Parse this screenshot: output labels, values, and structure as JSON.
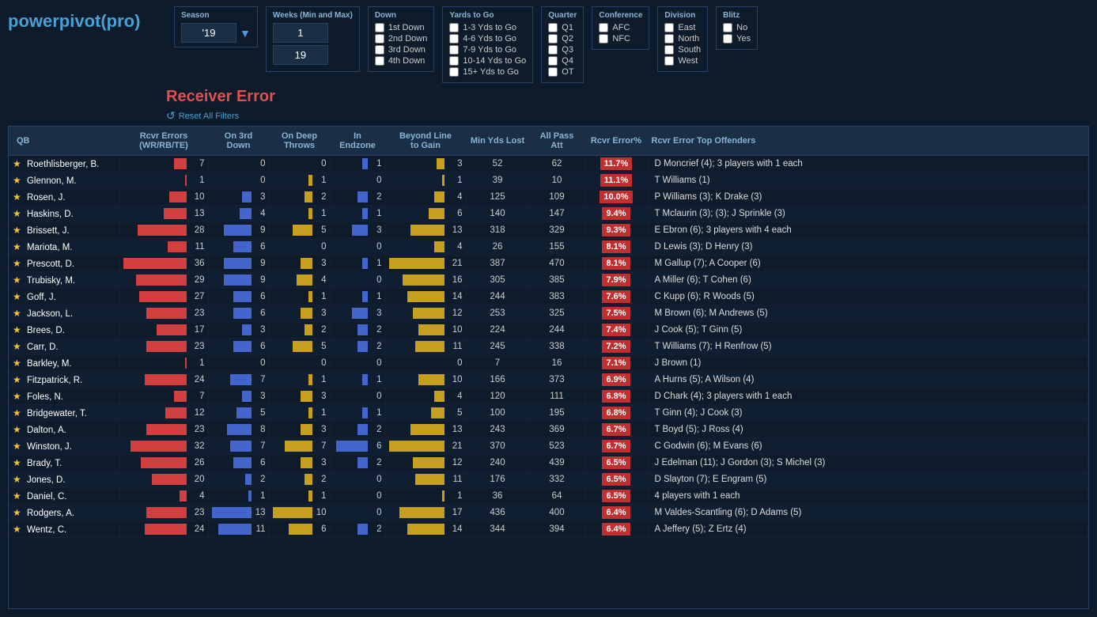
{
  "app": {
    "logo_prefix": "powerpivot",
    "logo_suffix": "(pro)",
    "subtitle": "Receiver Error",
    "reset_label": "Reset All Filters"
  },
  "season": {
    "label": "Season",
    "value": "'19"
  },
  "weeks": {
    "label": "Weeks (Min and Max)",
    "min": "1",
    "max": "19"
  },
  "down": {
    "label": "Down",
    "options": [
      "1st Down",
      "2nd Down",
      "3rd Down",
      "4th Down"
    ]
  },
  "yards_to_go": {
    "label": "Yards to Go",
    "options": [
      "1-3 Yds to Go",
      "4-6 Yds to Go",
      "7-9 Yds to Go",
      "10-14 Yds to Go",
      "15+ Yds to Go"
    ]
  },
  "quarter": {
    "label": "Quarter",
    "options": [
      "Q1",
      "Q2",
      "Q3",
      "Q4",
      "OT"
    ]
  },
  "conference": {
    "label": "Conference",
    "options": [
      "AFC",
      "NFC"
    ]
  },
  "division": {
    "label": "Division",
    "options": [
      "East",
      "North",
      "South",
      "West"
    ]
  },
  "blitz": {
    "label": "Blitz",
    "options": [
      "No",
      "Yes"
    ]
  },
  "table": {
    "headers": [
      "QB",
      "Rcvr Errors (WR/RB/TE)",
      "On 3rd Down",
      "On Deep Throws",
      "In Endzone",
      "Beyond Line to Gain",
      "Min Yds Lost",
      "All Pass Att",
      "Rcvr Error%",
      "Rcvr Error Top Offenders"
    ],
    "rows": [
      [
        "Roethlisberger, B.",
        "7",
        "0",
        "0",
        "1",
        "3",
        "52",
        "62",
        "11.7%",
        "D Moncrief (4); 3 players with 1 each",
        7,
        0,
        0,
        1,
        3
      ],
      [
        "Glennon, M.",
        "1",
        "0",
        "1",
        "0",
        "1",
        "39",
        "10",
        "11.1%",
        "T Williams (1)",
        1,
        0,
        1,
        0,
        1
      ],
      [
        "Rosen, J.",
        "10",
        "3",
        "2",
        "2",
        "4",
        "125",
        "109",
        "10.0%",
        "P Williams (3); K Drake (3)",
        10,
        3,
        2,
        2,
        4
      ],
      [
        "Haskins, D.",
        "13",
        "4",
        "1",
        "1",
        "6",
        "140",
        "147",
        "9.4%",
        "T Mclaurin (3); (3); J Sprinkle (3)",
        13,
        4,
        1,
        1,
        6
      ],
      [
        "Brissett, J.",
        "28",
        "9",
        "5",
        "3",
        "13",
        "318",
        "329",
        "9.3%",
        "E Ebron (6); 3 players with 4 each",
        28,
        9,
        5,
        3,
        13
      ],
      [
        "Mariota, M.",
        "11",
        "6",
        "0",
        "0",
        "4",
        "26",
        "155",
        "8.1%",
        "D Lewis (3); D Henry (3)",
        11,
        6,
        0,
        0,
        4
      ],
      [
        "Prescott, D.",
        "36",
        "9",
        "3",
        "1",
        "21",
        "387",
        "470",
        "8.1%",
        "M Gallup (7); A Cooper (6)",
        36,
        9,
        3,
        1,
        21
      ],
      [
        "Trubisky, M.",
        "29",
        "9",
        "4",
        "0",
        "16",
        "305",
        "385",
        "7.9%",
        "A Miller (6); T Cohen (6)",
        29,
        9,
        4,
        0,
        16
      ],
      [
        "Goff, J.",
        "27",
        "6",
        "1",
        "1",
        "14",
        "244",
        "383",
        "7.6%",
        "C Kupp (6); R Woods (5)",
        27,
        6,
        1,
        1,
        14
      ],
      [
        "Jackson, L.",
        "23",
        "6",
        "3",
        "3",
        "12",
        "253",
        "325",
        "7.5%",
        "M Brown (6); M Andrews (5)",
        23,
        6,
        3,
        3,
        12
      ],
      [
        "Brees, D.",
        "17",
        "3",
        "2",
        "2",
        "10",
        "224",
        "244",
        "7.4%",
        "J Cook (5); T Ginn (5)",
        17,
        3,
        2,
        2,
        10
      ],
      [
        "Carr, D.",
        "23",
        "6",
        "5",
        "2",
        "11",
        "245",
        "338",
        "7.2%",
        "T Williams (7); H Renfrow (5)",
        23,
        6,
        5,
        2,
        11
      ],
      [
        "Barkley, M.",
        "1",
        "0",
        "0",
        "0",
        "0",
        "7",
        "16",
        "7.1%",
        "J Brown (1)",
        1,
        0,
        0,
        0,
        0
      ],
      [
        "Fitzpatrick, R.",
        "24",
        "7",
        "1",
        "1",
        "10",
        "166",
        "373",
        "6.9%",
        "A Hurns (5); A Wilson (4)",
        24,
        7,
        1,
        1,
        10
      ],
      [
        "Foles, N.",
        "7",
        "3",
        "3",
        "0",
        "4",
        "120",
        "111",
        "6.8%",
        "D Chark (4); 3 players with 1 each",
        7,
        3,
        3,
        0,
        4
      ],
      [
        "Bridgewater, T.",
        "12",
        "5",
        "1",
        "1",
        "5",
        "100",
        "195",
        "6.8%",
        "T Ginn (4); J Cook (3)",
        12,
        5,
        1,
        1,
        5
      ],
      [
        "Dalton, A.",
        "23",
        "8",
        "3",
        "2",
        "13",
        "243",
        "369",
        "6.7%",
        "T Boyd (5); J Ross (4)",
        23,
        8,
        3,
        2,
        13
      ],
      [
        "Winston, J.",
        "32",
        "7",
        "7",
        "6",
        "21",
        "370",
        "523",
        "6.7%",
        "C Godwin (6); M Evans (6)",
        32,
        7,
        7,
        6,
        21
      ],
      [
        "Brady, T.",
        "26",
        "6",
        "3",
        "2",
        "12",
        "240",
        "439",
        "6.5%",
        "J Edelman (11); J Gordon (3); S Michel (3)",
        26,
        6,
        3,
        2,
        12
      ],
      [
        "Jones, D.",
        "20",
        "2",
        "2",
        "0",
        "11",
        "176",
        "332",
        "6.5%",
        "D Slayton (7); E Engram (5)",
        20,
        2,
        2,
        0,
        11
      ],
      [
        "Daniel, C.",
        "4",
        "1",
        "1",
        "0",
        "1",
        "36",
        "64",
        "6.5%",
        "4 players with 1 each",
        4,
        1,
        1,
        0,
        1
      ],
      [
        "Rodgers, A.",
        "23",
        "13",
        "10",
        "0",
        "17",
        "436",
        "400",
        "6.4%",
        "M Valdes-Scantling (6); D Adams (5)",
        23,
        13,
        10,
        0,
        17
      ],
      [
        "Wentz, C.",
        "24",
        "11",
        "6",
        "2",
        "14",
        "344",
        "394",
        "6.4%",
        "A Jeffery (5); Z Ertz (4)",
        24,
        11,
        6,
        2,
        14
      ]
    ]
  },
  "colors": {
    "accent": "#4a9fd4",
    "red_bar": "#d04040",
    "blue_bar": "#4466cc",
    "gold_bar": "#c8a020",
    "error_pct_bg": "#c03030",
    "header_bg": "#1a2e45",
    "row_bg1": "#0d1b2a",
    "row_bg2": "#0f1e30"
  }
}
